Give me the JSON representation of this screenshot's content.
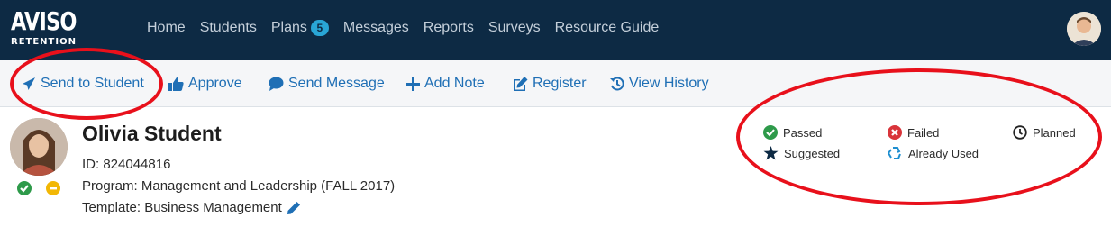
{
  "app": {
    "logo_main": "AVISO",
    "logo_sub": "RETENTION"
  },
  "nav": {
    "items": [
      {
        "label": "Home"
      },
      {
        "label": "Students"
      },
      {
        "label": "Plans",
        "badge": "5"
      },
      {
        "label": "Messages"
      },
      {
        "label": "Reports"
      },
      {
        "label": "Surveys"
      },
      {
        "label": "Resource Guide"
      }
    ]
  },
  "toolbar": {
    "send_to_student": "Send to Student",
    "approve": "Approve",
    "send_message": "Send Message",
    "add_note": "Add Note",
    "register": "Register",
    "view_history": "View History"
  },
  "student": {
    "name": "Olivia Student",
    "id_line": "ID: 824044816",
    "program_line": "Program: Management and Leadership (FALL 2017)",
    "template_line": "Template: Business Management"
  },
  "legend": {
    "passed": "Passed",
    "failed": "Failed",
    "planned": "Planned",
    "suggested": "Suggested",
    "already_used": "Already Used"
  },
  "colors": {
    "navbar": "#0d2a44",
    "link": "#1f6fb5",
    "badge": "#29a6d6",
    "passed": "#2e9a4a",
    "failed": "#d9343a",
    "warning": "#f2b705",
    "annotation": "#e8101b"
  },
  "icons": [
    "paper-plane-icon",
    "thumbs-up-icon",
    "comment-icon",
    "plus-icon",
    "edit-icon",
    "history-icon",
    "pencil-icon",
    "check-circle-icon",
    "times-circle-icon",
    "clock-icon",
    "star-icon",
    "recycle-icon",
    "minus-circle-icon"
  ]
}
